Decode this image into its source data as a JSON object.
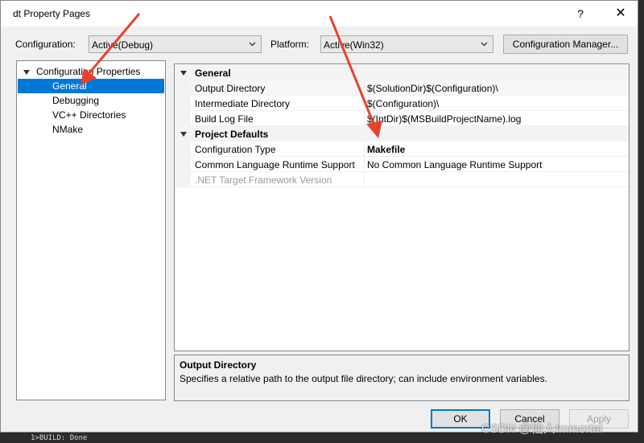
{
  "window": {
    "title": "dt Property Pages",
    "help_label": "?",
    "close_label": "✕"
  },
  "toolbar": {
    "configuration_label": "Configuration:",
    "configuration_value": "Active(Debug)",
    "platform_label": "Platform:",
    "platform_value": "Active(Win32)",
    "config_manager_label": "Configuration Manager..."
  },
  "tree": {
    "root": "Configuration Properties",
    "items": [
      {
        "label": "General",
        "selected": true
      },
      {
        "label": "Debugging"
      },
      {
        "label": "VC++ Directories"
      },
      {
        "label": "NMake"
      }
    ]
  },
  "grid": {
    "sections": [
      {
        "title": "General",
        "rows": [
          {
            "name": "Output Directory",
            "value": "$(SolutionDir)$(Configuration)\\"
          },
          {
            "name": "Intermediate Directory",
            "value": "$(Configuration)\\"
          },
          {
            "name": "Build Log File",
            "value": "$(IntDir)$(MSBuildProjectName).log"
          }
        ]
      },
      {
        "title": "Project Defaults",
        "rows": [
          {
            "name": "Configuration Type",
            "value": "Makefile"
          },
          {
            "name": "Common Language Runtime Support",
            "value": "No Common Language Runtime Support"
          },
          {
            "name": ".NET Target Framework Version",
            "value": ""
          }
        ]
      }
    ]
  },
  "description": {
    "title": "Output Directory",
    "text": "Specifies a relative path to the output file directory; can include environment variables."
  },
  "buttons": {
    "ok": "OK",
    "cancel": "Cancel",
    "apply": "Apply"
  },
  "watermark": "CSDN @仙人Immortal",
  "console_text": "1>BUILD: Done",
  "colors": {
    "selection": "#0078d7",
    "annotation_arrow": "#e8412c"
  }
}
